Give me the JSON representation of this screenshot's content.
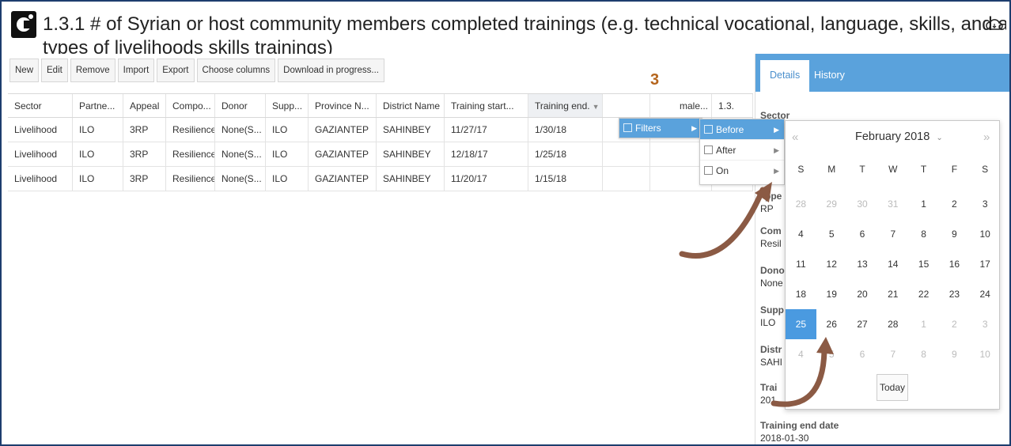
{
  "header": {
    "title": "1.3.1 # of Syrian or host community members completed trainings (e.g. technical vocational, language, skills, and all",
    "title_line2": "types of livelihoods skills trainings)"
  },
  "toolbar": {
    "new": "New",
    "edit": "Edit",
    "remove": "Remove",
    "import": "Import",
    "export": "Export",
    "choose_columns": "Choose columns",
    "download": "Download in progress..."
  },
  "annotation": {
    "step": "3"
  },
  "grid": {
    "columns": [
      "Sector",
      "Partne...",
      "Appeal",
      "Compo...",
      "Donor",
      "Supp...",
      "Province N...",
      "District Name",
      "Training start...",
      "Training end.",
      "",
      "male...",
      "1.3."
    ],
    "rows": [
      [
        "Livelihood",
        "ILO",
        "3RP",
        "Resilience",
        "None(S...",
        "ILO",
        "GAZIANTEP",
        "SAHINBEY",
        "11/27/17",
        "1/30/18",
        "",
        "",
        ""
      ],
      [
        "Livelihood",
        "ILO",
        "3RP",
        "Resilience",
        "None(S...",
        "ILO",
        "GAZIANTEP",
        "SAHINBEY",
        "12/18/17",
        "1/25/18",
        "",
        "",
        ""
      ],
      [
        "Livelihood",
        "ILO",
        "3RP",
        "Resilience",
        "None(S...",
        "ILO",
        "GAZIANTEP",
        "SAHINBEY",
        "11/20/17",
        "1/15/18",
        "",
        "",
        ""
      ]
    ]
  },
  "side": {
    "tabs": [
      "Details",
      "History"
    ],
    "fields": {
      "sector": "Sector",
      "appeal_label": "ppe",
      "appeal_value": "RP",
      "comp_label": "Com",
      "comp_value": "Resil",
      "donor_label": "Dono",
      "donor_value": "None",
      "supp_label": "Supp",
      "supp_value": "ILO",
      "dist_label": "Distr",
      "dist_value": "SAHI",
      "train_label": "Trai",
      "train_value": "201",
      "end_label": "Training end date",
      "end_value": "2018-01-30"
    }
  },
  "menus": {
    "filters": "Filters",
    "before": "Before",
    "after": "After",
    "on": "On"
  },
  "calendar": {
    "month": "February 2018",
    "prev": "«",
    "next": "»",
    "weekdays": [
      "S",
      "M",
      "T",
      "W",
      "T",
      "F",
      "S"
    ],
    "weeks": [
      [
        [
          "28",
          1
        ],
        [
          "29",
          1
        ],
        [
          "30",
          1
        ],
        [
          "31",
          1
        ],
        [
          "1",
          0
        ],
        [
          "2",
          0
        ],
        [
          "3",
          0
        ]
      ],
      [
        [
          "4",
          0
        ],
        [
          "5",
          0
        ],
        [
          "6",
          0
        ],
        [
          "7",
          0
        ],
        [
          "8",
          0
        ],
        [
          "9",
          0
        ],
        [
          "10",
          0
        ]
      ],
      [
        [
          "11",
          0
        ],
        [
          "12",
          0
        ],
        [
          "13",
          0
        ],
        [
          "14",
          0
        ],
        [
          "15",
          0
        ],
        [
          "16",
          0
        ],
        [
          "17",
          0
        ]
      ],
      [
        [
          "18",
          0
        ],
        [
          "19",
          0
        ],
        [
          "20",
          0
        ],
        [
          "21",
          0
        ],
        [
          "22",
          0
        ],
        [
          "23",
          0
        ],
        [
          "24",
          0
        ]
      ],
      [
        [
          "25",
          0
        ],
        [
          "26",
          0
        ],
        [
          "27",
          0
        ],
        [
          "28",
          0
        ],
        [
          "1",
          1
        ],
        [
          "2",
          1
        ],
        [
          "3",
          1
        ]
      ],
      [
        [
          "4",
          1
        ],
        [
          "5",
          1
        ],
        [
          "6",
          1
        ],
        [
          "7",
          1
        ],
        [
          "8",
          1
        ],
        [
          "9",
          1
        ],
        [
          "10",
          1
        ]
      ]
    ],
    "selected": "25",
    "today": "Today"
  },
  "colors": {
    "accent": "#5aa2dc",
    "selected": "#4a9ae0",
    "arrow": "#8b5a44",
    "annotation": "#b5651d"
  }
}
